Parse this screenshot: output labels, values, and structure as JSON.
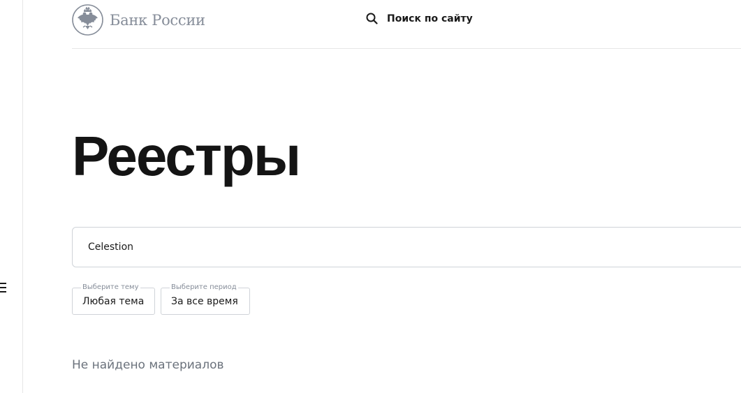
{
  "header": {
    "logo_text": "Банк России",
    "site_search_label": "Поиск по сайту"
  },
  "main": {
    "title": "Реестры",
    "search": {
      "value": "Celestion"
    },
    "filters": [
      {
        "legend": "Выберите тему",
        "value": "Любая тема"
      },
      {
        "legend": "Выберите период",
        "value": "За все время"
      }
    ],
    "empty_message": "Не найдено материалов"
  },
  "icons": {
    "logo": "double-headed-eagle-emblem",
    "search": "search-icon",
    "menu": "hamburger-menu-icon"
  },
  "colors": {
    "logo_gray": "#868d99",
    "text": "#1a1a1a",
    "muted": "#6b727c",
    "border": "#cfd3d8"
  }
}
